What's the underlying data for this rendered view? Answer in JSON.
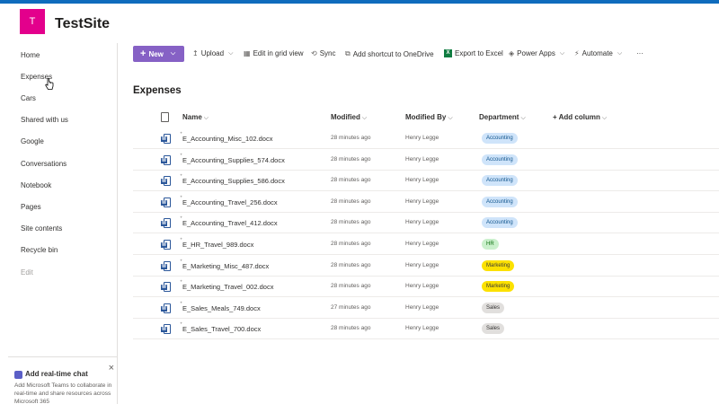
{
  "header": {
    "logo_letter": "T",
    "site_title": "TestSite",
    "brand_color": "#0f6cbd",
    "logo_color": "#e3008c"
  },
  "nav": {
    "items": [
      {
        "label": "Home"
      },
      {
        "label": "Expenses"
      },
      {
        "label": "Cars"
      },
      {
        "label": "Shared with us"
      },
      {
        "label": "Google"
      },
      {
        "label": "Conversations"
      },
      {
        "label": "Notebook"
      },
      {
        "label": "Pages"
      },
      {
        "label": "Site contents"
      },
      {
        "label": "Recycle bin"
      },
      {
        "label": "Edit"
      }
    ]
  },
  "chat": {
    "title": "Add real-time chat",
    "description": "Add Microsoft Teams to collaborate in real-time and share resources across Microsoft 365",
    "close_icon": "×"
  },
  "commands": {
    "new": "New",
    "upload": "Upload",
    "grid": "Edit in grid view",
    "sync": "Sync",
    "shortcut": "Add shortcut to OneDrive",
    "export": "Export to Excel",
    "powerapps": "Power Apps",
    "automate": "Automate",
    "more": "···"
  },
  "list": {
    "title": "Expenses",
    "columns": {
      "name": "Name",
      "modified": "Modified",
      "modified_by": "Modified By",
      "department": "Department",
      "add_column": "Add column"
    },
    "rows": [
      {
        "name": "E_Accounting_Misc_102.docx",
        "modified": "28 minutes ago",
        "by": "Henry Legge",
        "dept": "Accounting"
      },
      {
        "name": "E_Accounting_Supplies_574.docx",
        "modified": "28 minutes ago",
        "by": "Henry Legge",
        "dept": "Accounting"
      },
      {
        "name": "E_Accounting_Supplies_586.docx",
        "modified": "28 minutes ago",
        "by": "Henry Legge",
        "dept": "Accounting"
      },
      {
        "name": "E_Accounting_Travel_256.docx",
        "modified": "28 minutes ago",
        "by": "Henry Legge",
        "dept": "Accounting"
      },
      {
        "name": "E_Accounting_Travel_412.docx",
        "modified": "28 minutes ago",
        "by": "Henry Legge",
        "dept": "Accounting"
      },
      {
        "name": "E_HR_Travel_989.docx",
        "modified": "28 minutes ago",
        "by": "Henry Legge",
        "dept": "HR"
      },
      {
        "name": "E_Marketing_Misc_487.docx",
        "modified": "28 minutes ago",
        "by": "Henry Legge",
        "dept": "Marketing"
      },
      {
        "name": "E_Marketing_Travel_002.docx",
        "modified": "28 minutes ago",
        "by": "Henry Legge",
        "dept": "Marketing"
      },
      {
        "name": "E_Sales_Meals_749.docx",
        "modified": "27 minutes ago",
        "by": "Henry Legge",
        "dept": "Sales"
      },
      {
        "name": "E_Sales_Travel_700.docx",
        "modified": "28 minutes ago",
        "by": "Henry Legge",
        "dept": "Sales"
      }
    ]
  },
  "pill_colors": {
    "Accounting": {
      "bg": "#cfe4fa",
      "fg": "#0f548c"
    },
    "HR": {
      "bg": "#caf0cc",
      "fg": "#0e700e"
    },
    "Marketing": {
      "bg": "#fce100",
      "fg": "#3b3a39"
    },
    "Sales": {
      "bg": "#e1dfdd",
      "fg": "#323130"
    }
  }
}
